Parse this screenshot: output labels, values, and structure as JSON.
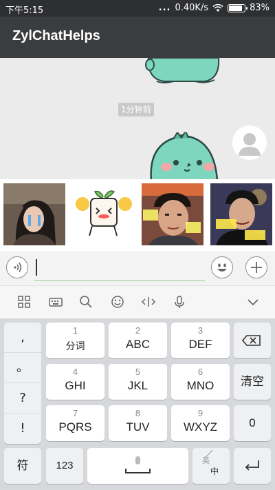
{
  "status": {
    "time": "下午5:15",
    "dots": "...",
    "speed": "0.40K/s",
    "battery": "83%"
  },
  "app": {
    "title": "ZylChatHelps"
  },
  "chat": {
    "timestamp": "1分钟前"
  },
  "keyboard": {
    "side": [
      ",",
      "。",
      "?",
      "!"
    ],
    "keys": [
      {
        "num": "1",
        "label": "分词"
      },
      {
        "num": "2",
        "label": "ABC"
      },
      {
        "num": "3",
        "label": "DEF"
      },
      {
        "num": "4",
        "label": "GHI"
      },
      {
        "num": "5",
        "label": "JKL"
      },
      {
        "num": "6",
        "label": "MNO"
      },
      {
        "num": "7",
        "label": "PQRS"
      },
      {
        "num": "8",
        "label": "TUV"
      },
      {
        "num": "9",
        "label": "WXYZ"
      }
    ],
    "clear": "清空",
    "zero": "0",
    "symbol": "符",
    "numbers": "123",
    "lang_en": "英",
    "lang_zh": "中"
  },
  "colors": {
    "statusbar": "#2e2f31",
    "appbar": "#3a3c3e",
    "chat_bg": "#ebebeb",
    "accent": "#8fd18a",
    "keyboard_bg": "#d6d8db"
  }
}
